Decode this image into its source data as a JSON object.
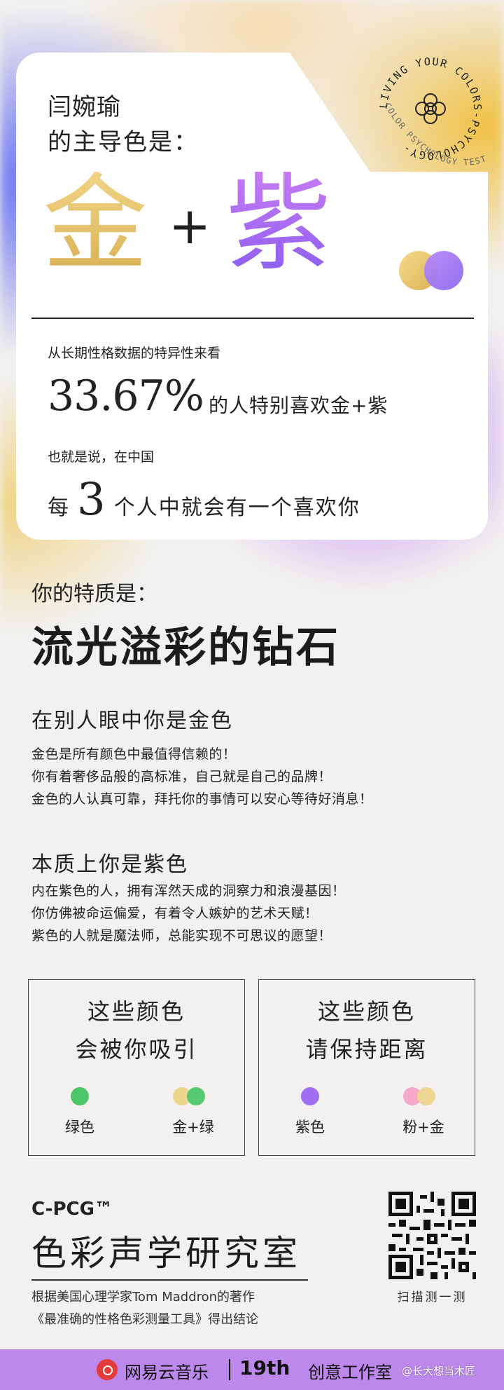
{
  "card": {
    "name": "闫婉瑜",
    "lead": "的主导色是：",
    "color_a": "金",
    "plus": "+",
    "color_b": "紫",
    "stat_intro": "从长期性格数据的特异性来看",
    "stat_percent": "33.67%",
    "stat_tail": "的人特别喜欢金+紫",
    "also": "也就是说，在中国",
    "every_pre": "每",
    "every_num": "3",
    "every_post": "个人中就会有一个喜欢你",
    "badge_ring": "LIVING YOUR COLORS-PSYCHOLOGY-",
    "badge_sub": "- COLOR PSYCHOLOGY TEST -"
  },
  "traits": {
    "label": "你的特质是：",
    "title": "流光溢彩的钻石"
  },
  "sections": [
    {
      "title": "在别人眼中你是金色",
      "lines": [
        "金色是所有颜色中最值得信赖的！",
        "你有着奢侈品般的高标准，自己就是自己的品牌！",
        "金色的人认真可靠，拜托你的事情可以安心等待好消息！"
      ]
    },
    {
      "title": "本质上你是紫色",
      "lines": [
        "内在紫色的人，拥有浑然天成的洞察力和浪漫基因！",
        "你仿佛被命运偏爱，有着令人嫉妒的艺术天赋！",
        "紫色的人就是魔法师，总能实现不可思议的愿望！"
      ]
    }
  ],
  "attract": {
    "title_1": "这些颜色",
    "title_2": "会被你吸引",
    "items": [
      {
        "label": "绿色"
      },
      {
        "label": "金+绿"
      }
    ]
  },
  "avoid": {
    "title_1": "这些颜色",
    "title_2": "请保持距离",
    "items": [
      {
        "label": "紫色"
      },
      {
        "label": "粉+金"
      }
    ]
  },
  "brand": {
    "tag": "C-PCG™",
    "title": "色彩声学研究室",
    "note_1": "根据美国心理学家Tom Maddron的著作",
    "note_2": "《最准确的性格色彩测量工具》得出结论",
    "qr_label": "扫描测一测"
  },
  "footer": {
    "app": "网易云音乐",
    "studio_bold": "19th",
    "studio": "创意工作室",
    "watermark": "@长大想当木匠"
  },
  "colors": {
    "gold": "#e2be66",
    "purple": "#a26ff3",
    "green": "#4fc56a",
    "pink": "#f3a9c7",
    "footer_bg": "#bd88ec"
  }
}
